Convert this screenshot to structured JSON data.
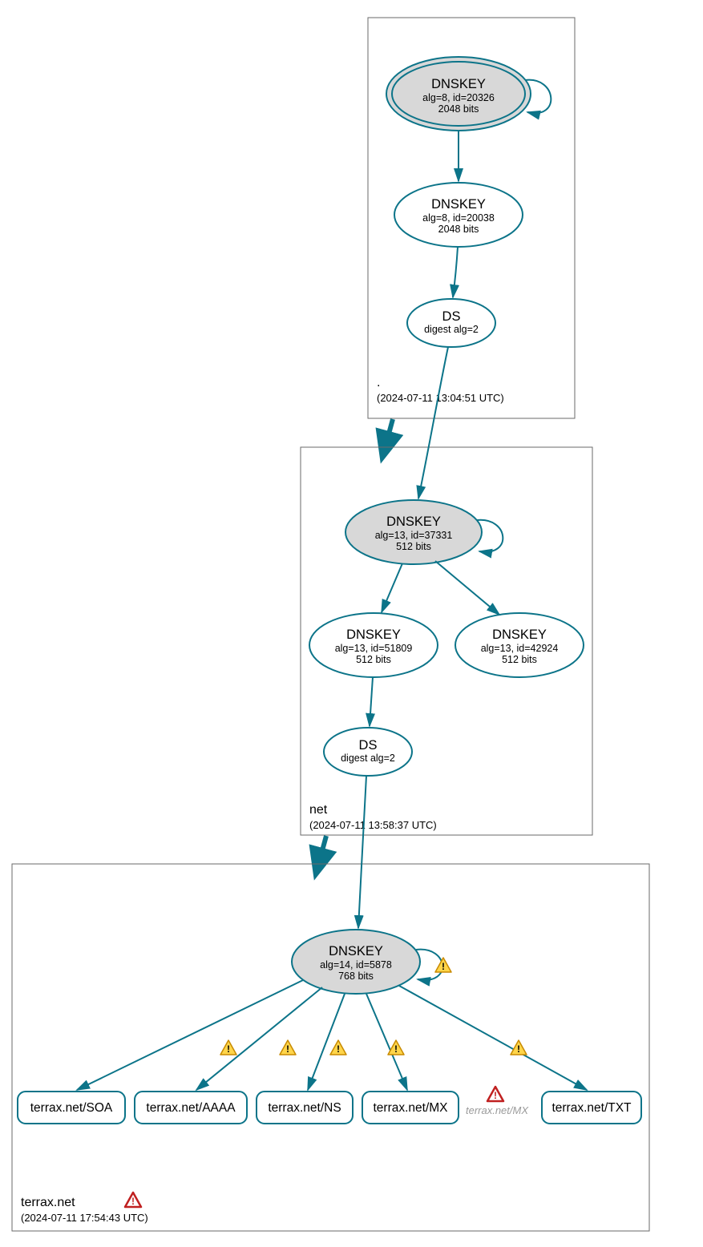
{
  "zones": {
    "root": {
      "name": ".",
      "timestamp": "(2024-07-11 13:04:51 UTC)",
      "nodes": {
        "ksk": {
          "title": "DNSKEY",
          "line1": "alg=8, id=20326",
          "line2": "2048 bits"
        },
        "zsk": {
          "title": "DNSKEY",
          "line1": "alg=8, id=20038",
          "line2": "2048 bits"
        },
        "ds": {
          "title": "DS",
          "line1": "digest alg=2"
        }
      }
    },
    "net": {
      "name": "net",
      "timestamp": "(2024-07-11 13:58:37 UTC)",
      "nodes": {
        "ksk": {
          "title": "DNSKEY",
          "line1": "alg=13, id=37331",
          "line2": "512 bits"
        },
        "zskA": {
          "title": "DNSKEY",
          "line1": "alg=13, id=51809",
          "line2": "512 bits"
        },
        "zskB": {
          "title": "DNSKEY",
          "line1": "alg=13, id=42924",
          "line2": "512 bits"
        },
        "ds": {
          "title": "DS",
          "line1": "digest alg=2"
        }
      }
    },
    "terrax": {
      "name": "terrax.net",
      "timestamp": "(2024-07-11 17:54:43 UTC)",
      "nodes": {
        "ksk": {
          "title": "DNSKEY",
          "line1": "alg=14, id=5878",
          "line2": "768 bits"
        },
        "rr1": {
          "label": "terrax.net/SOA"
        },
        "rr2": {
          "label": "terrax.net/AAAA"
        },
        "rr3": {
          "label": "terrax.net/NS"
        },
        "rr4": {
          "label": "terrax.net/MX"
        },
        "rr5": {
          "label": "terrax.net/MX"
        },
        "rr6": {
          "label": "terrax.net/TXT"
        }
      }
    }
  }
}
